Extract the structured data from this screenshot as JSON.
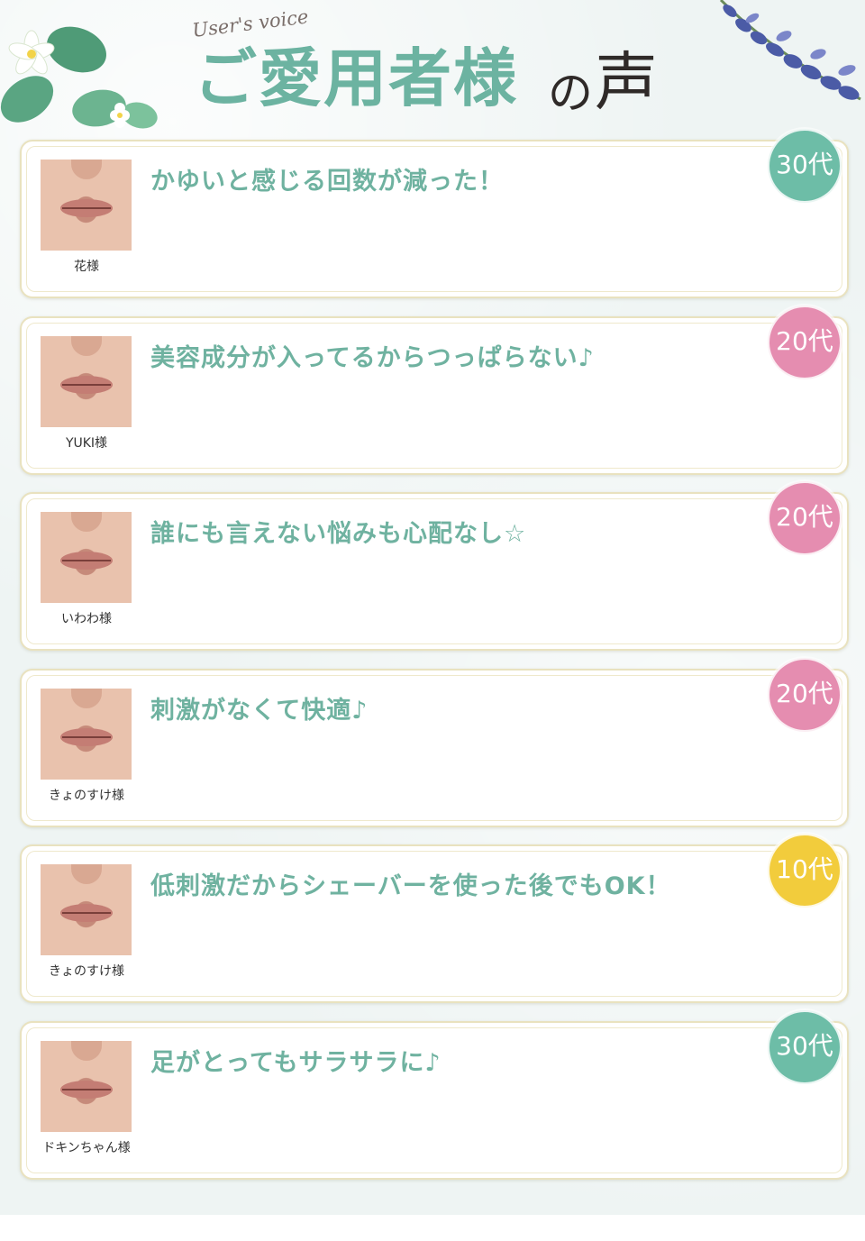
{
  "header": {
    "subtitle": "User's voice",
    "title_main": "ご愛用者様",
    "title_no": "の",
    "title_koe": "声"
  },
  "colors": {
    "accent_green": "#6fb2a0",
    "badge_30s": "#6dbda7",
    "badge_20s": "#e58db0",
    "badge_10s": "#f2cc3c"
  },
  "reviews": [
    {
      "name": "花様",
      "comment": "かゆいと感じる回数が減った！",
      "age": "30代",
      "badge_color": "#6dbda7"
    },
    {
      "name": "YUKI様",
      "comment": "美容成分が入ってるからつっぱらない♪",
      "age": "20代",
      "badge_color": "#e58db0"
    },
    {
      "name": "いわわ様",
      "comment": "誰にも言えない悩みも心配なし☆",
      "age": "20代",
      "badge_color": "#e58db0"
    },
    {
      "name": "きょのすけ様",
      "comment": "刺激がなくて快適♪",
      "age": "20代",
      "badge_color": "#e58db0"
    },
    {
      "name": "きょのすけ様",
      "comment": "低刺激だからシェーバーを使った後でもOK！",
      "age": "10代",
      "badge_color": "#f2cc3c"
    },
    {
      "name": "ドキンちゃん様",
      "comment": "足がとってもサラサラに♪",
      "age": "30代",
      "badge_color": "#6dbda7"
    }
  ]
}
